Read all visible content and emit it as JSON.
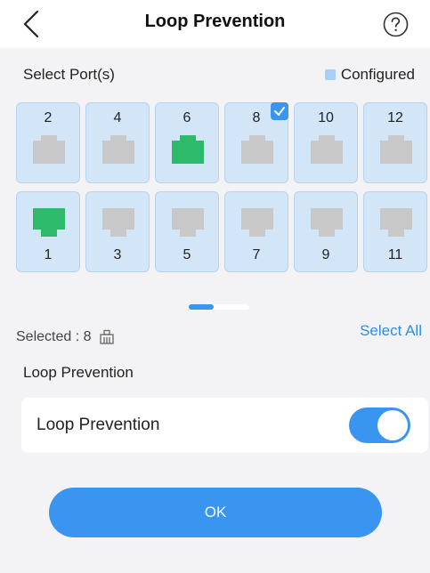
{
  "header": {
    "title": "Loop Prevention",
    "back_icon": "chevron-left-icon",
    "help_icon": "question-circle-icon"
  },
  "port_section": {
    "label": "Select Port(s)",
    "legend": "Configured",
    "legend_color": "#a8cff6"
  },
  "ports": {
    "top": [
      {
        "num": "2",
        "status": "gray"
      },
      {
        "num": "4",
        "status": "gray"
      },
      {
        "num": "6",
        "status": "green"
      },
      {
        "num": "8",
        "status": "gray",
        "checked": true
      },
      {
        "num": "10",
        "status": "gray"
      },
      {
        "num": "12",
        "status": "gray"
      }
    ],
    "bottom": [
      {
        "num": "1",
        "status": "green"
      },
      {
        "num": "3",
        "status": "gray"
      },
      {
        "num": "5",
        "status": "gray"
      },
      {
        "num": "7",
        "status": "gray"
      },
      {
        "num": "9",
        "status": "gray"
      },
      {
        "num": "11",
        "status": "gray"
      }
    ]
  },
  "selection": {
    "selected_text": "Selected : 8",
    "select_all": "Select All"
  },
  "loop": {
    "section_label": "Loop Prevention",
    "row_label": "Loop Prevention",
    "enabled": true
  },
  "actions": {
    "ok_label": "OK"
  },
  "colors": {
    "accent": "#3a95f0",
    "port_gray": "#c8c8c8",
    "port_green": "#2dbb6b",
    "port_bg": "#d3e6f8"
  }
}
